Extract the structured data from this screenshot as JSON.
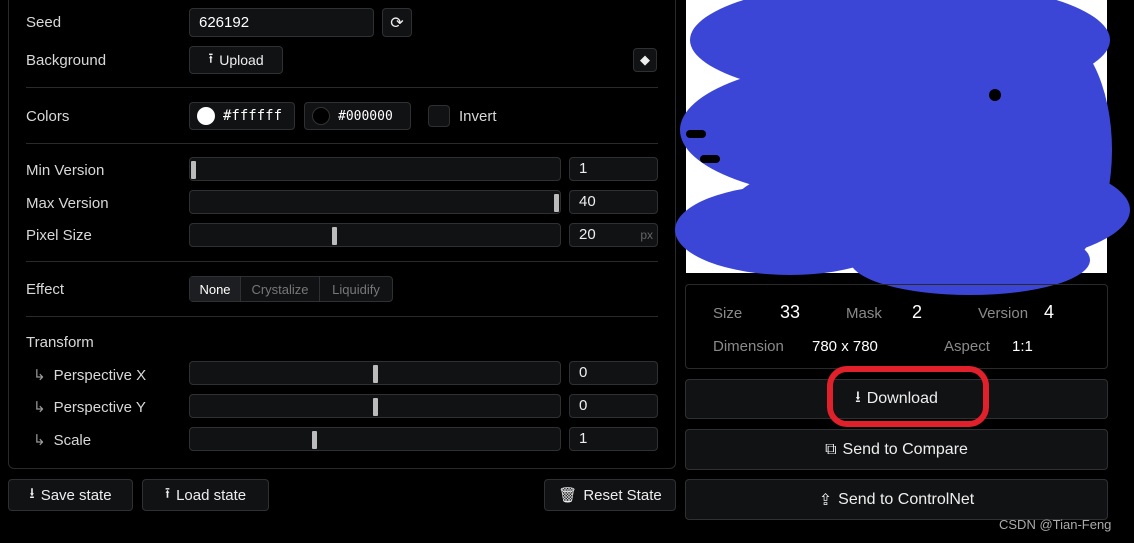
{
  "seed": {
    "label": "Seed",
    "value": "626192"
  },
  "background": {
    "label": "Background",
    "upload": "Upload"
  },
  "colors": {
    "label": "Colors",
    "light": "#ffffff",
    "dark": "#000000",
    "invert": "Invert"
  },
  "min_version": {
    "label": "Min Version",
    "value": "1",
    "fraction": 0.0
  },
  "max_version": {
    "label": "Max Version",
    "value": "40",
    "fraction": 1.0
  },
  "pixel_size": {
    "label": "Pixel Size",
    "value": "20",
    "unit": "px",
    "fraction": 0.38
  },
  "effect": {
    "label": "Effect",
    "options": [
      "None",
      "Crystalize",
      "Liquidify"
    ],
    "selected": "None"
  },
  "transform": {
    "label": "Transform",
    "perspective_x": {
      "label": "Perspective X",
      "value": "0",
      "fraction": 0.5
    },
    "perspective_y": {
      "label": "Perspective Y",
      "value": "0",
      "fraction": 0.5
    },
    "scale": {
      "label": "Scale",
      "value": "1",
      "fraction": 0.33
    }
  },
  "actions": {
    "save": "Save state",
    "load": "Load state",
    "reset": "Reset State"
  },
  "stats": {
    "size_label": "Size",
    "size": "33",
    "mask_label": "Mask",
    "mask": "2",
    "version_label": "Version",
    "version": "4",
    "dimension_label": "Dimension",
    "dimension": "780 x 780",
    "aspect_label": "Aspect",
    "aspect": "1:1"
  },
  "buttons": {
    "download": "Download",
    "compare": "Send to Compare",
    "controlnet": "Send to ControlNet"
  },
  "watermark": "CSDN @Tian-Feng",
  "highlight_color": "#e0202a",
  "scribble_color": "#3b46d6"
}
